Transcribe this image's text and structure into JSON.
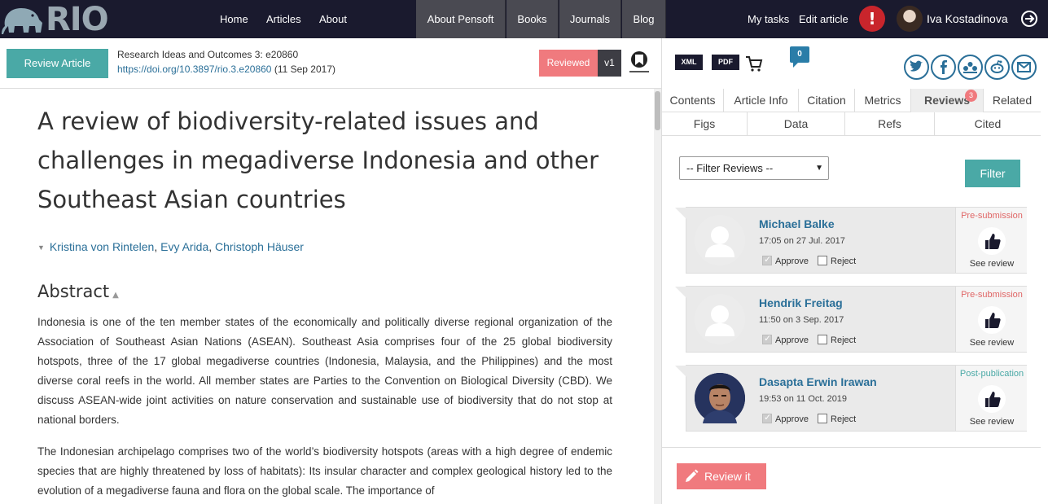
{
  "nav": {
    "logo": "RIO",
    "links": [
      "Home",
      "Articles",
      "About"
    ],
    "tabs": [
      "About Pensoft",
      "Books",
      "Journals",
      "Blog"
    ],
    "my_tasks": "My tasks",
    "edit_article": "Edit article",
    "alert": "!",
    "user_name": "Iva Kostadinova"
  },
  "subheader": {
    "review_button": "Review Article",
    "journal": "Research Ideas and Outcomes 3: e20860",
    "doi": "https://doi.org/10.3897/rio.3.e20860",
    "date": "(11 Sep 2017)",
    "reviewed": "Reviewed",
    "version": "v1"
  },
  "tools": {
    "xml": "XML",
    "pdf": "PDF",
    "comments": "0"
  },
  "article": {
    "title": "A review of biodiversity-related issues and challenges in megadiverse Indonesia and other Southeast Asian countries",
    "authors": [
      "Kristina von Rintelen",
      "Evy Arida",
      "Christoph Häuser"
    ],
    "author_sep": ", ",
    "abstract_heading": "Abstract",
    "paragraph1": "Indonesia is one of the ten member states of the economically and politically diverse regional organization of the Association of Southeast Asian Nations (ASEAN). Southeast Asia comprises four of the 25 global biodiversity hotspots, three of the 17 global megadiverse countries (Indonesia, Malaysia, and the Philippines) and the most diverse coral reefs in the world. All member states are Parties to the Convention on Biological Diversity (CBD). We discuss ASEAN-wide joint activities on nature conservation and sustainable use of biodiversity that do not stop at national borders.",
    "paragraph2": "The Indonesian archipelago comprises two of the world’s biodiversity hotspots (areas with a high degree of endemic species that are highly threatened by loss of habitats): Its insular character and complex geological history led to the evolution of a megadiverse fauna and flora on the global scale. The importance of"
  },
  "panel": {
    "tabs": [
      "Contents",
      "Article Info",
      "Citation",
      "Metrics",
      "Reviews",
      "Related"
    ],
    "reviews_badge": "3",
    "subtabs": [
      "Figs",
      "Data",
      "Refs",
      "Cited"
    ],
    "filter_select": "-- Filter Reviews --",
    "filter_button": "Filter",
    "reviews": [
      {
        "name": "Michael Balke",
        "date": "17:05 on 27 Jul. 2017",
        "stage": "Pre-submission",
        "approve": "Approve",
        "reject": "Reject",
        "see": "See review"
      },
      {
        "name": "Hendrik Freitag",
        "date": "11:50 on 3 Sep. 2017",
        "stage": "Pre-submission",
        "approve": "Approve",
        "reject": "Reject",
        "see": "See review"
      },
      {
        "name": "Dasapta Erwin Irawan",
        "date": "19:53 on 11 Oct. 2019",
        "stage": "Post-publication",
        "approve": "Approve",
        "reject": "Reject",
        "see": "See review"
      }
    ],
    "review_it": "Review it"
  },
  "colors": {
    "nav_bg": "#1a1a2e",
    "teal": "#4aa9a6",
    "coral": "#f07a7e",
    "link": "#2a6f98",
    "pre_submission": "#e06666",
    "post_publication": "#4aa9a6"
  }
}
